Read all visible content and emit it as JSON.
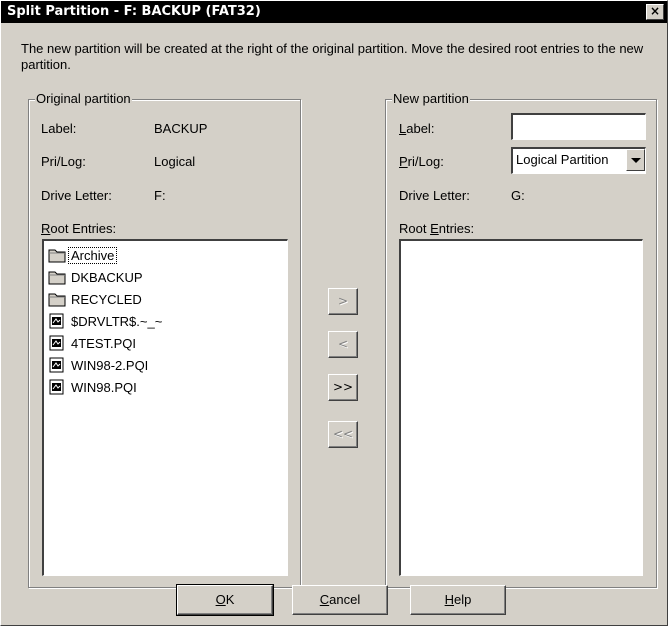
{
  "window": {
    "title": "Split Partition - F: BACKUP (FAT32)",
    "close_glyph": "×"
  },
  "description": "The new partition will be created at the right of the original partition. Move the desired root entries to the new partition.",
  "original": {
    "group_title": "Original partition",
    "label_caption": "Label:",
    "label_value": "BACKUP",
    "prilog_caption": "Pri/Log:",
    "prilog_value": "Logical",
    "drive_caption": "Drive Letter:",
    "drive_value": "F:",
    "root_caption_u": "R",
    "root_caption_rest": "oot Entries:",
    "entries": [
      {
        "name": "Archive",
        "icon": "folder-icon"
      },
      {
        "name": "DKBACKUP",
        "icon": "folder-icon"
      },
      {
        "name": "RECYCLED",
        "icon": "folder-icon"
      },
      {
        "name": "$DRVLTR$.~_~",
        "icon": "file-icon"
      },
      {
        "name": "4TEST.PQI",
        "icon": "file-icon"
      },
      {
        "name": "WIN98-2.PQI",
        "icon": "file-icon"
      },
      {
        "name": "WIN98.PQI",
        "icon": "file-icon"
      }
    ]
  },
  "new": {
    "group_title": "New partition",
    "label_caption_u": "L",
    "label_caption_rest": "abel:",
    "label_value": "",
    "prilog_caption_u": "P",
    "prilog_caption_rest": "ri/Log:",
    "prilog_value": "Logical Partition",
    "drive_caption": "Drive Letter:",
    "drive_value": "G:",
    "root_caption_pre": "Root ",
    "root_caption_u": "E",
    "root_caption_rest": "ntries:"
  },
  "move_buttons": {
    "move_right": ">",
    "move_left": "<",
    "move_all_right": ">>",
    "move_all_left": "<<"
  },
  "buttons": {
    "ok_u": "O",
    "ok_rest": "K",
    "cancel_u": "C",
    "cancel_rest": "ancel",
    "help_u": "H",
    "help_rest": "elp"
  }
}
